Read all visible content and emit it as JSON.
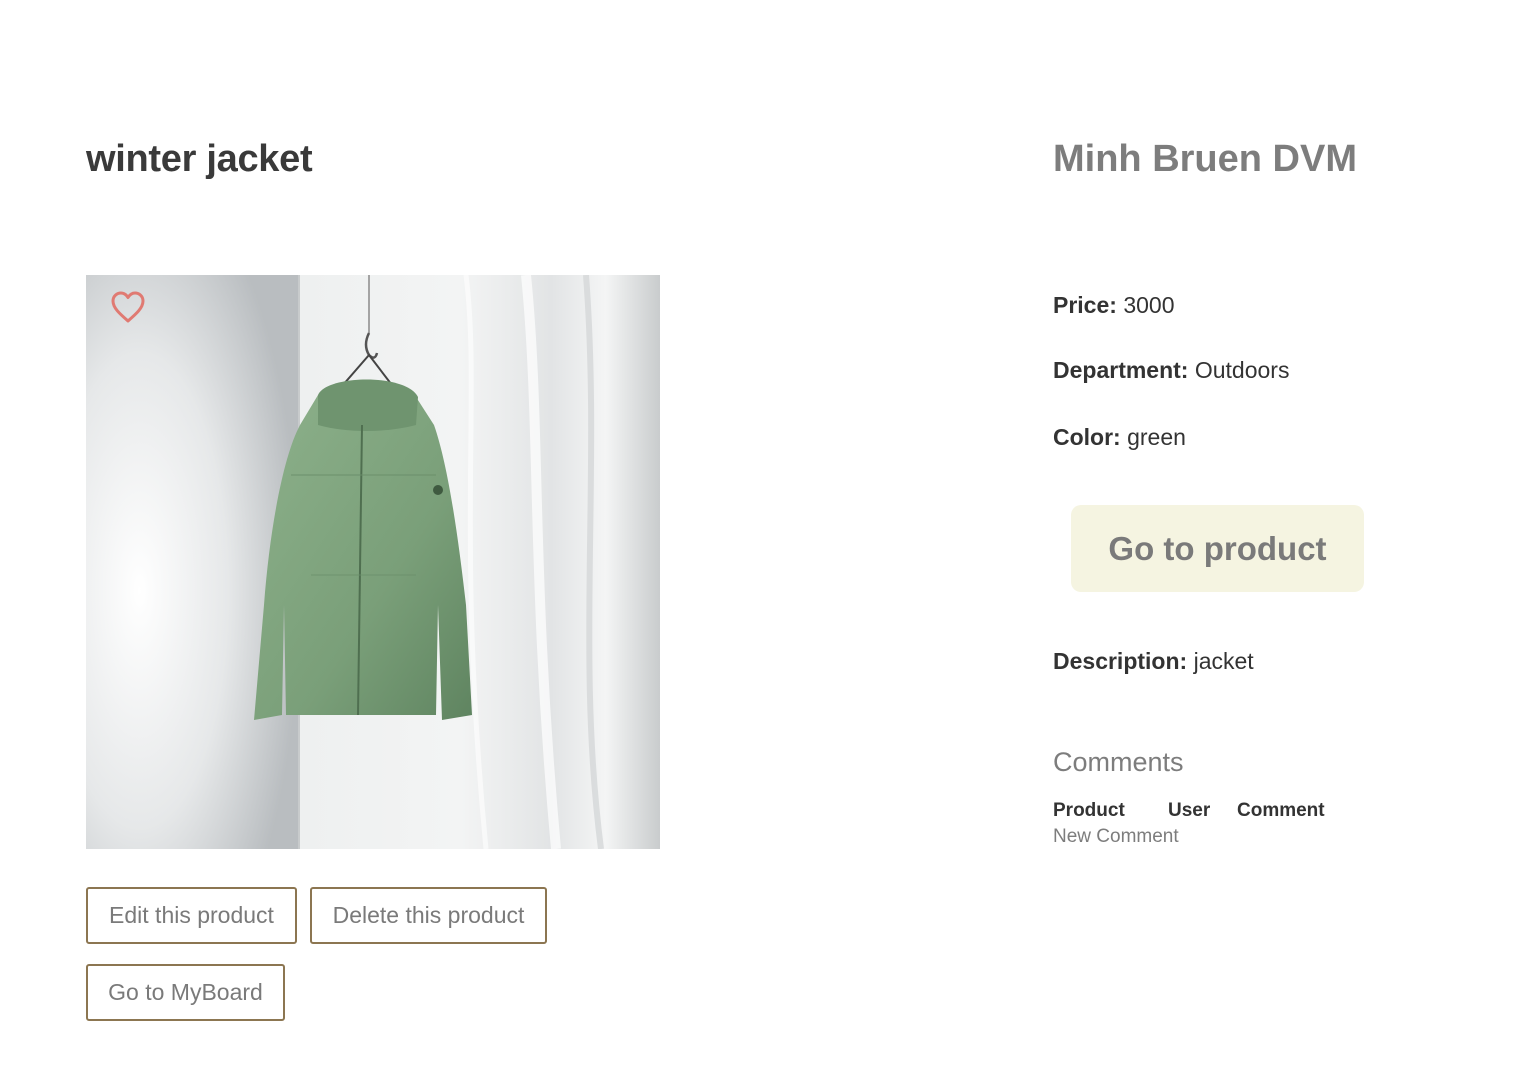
{
  "product": {
    "title": "winter jacket",
    "image_alt": "green hooded jacket hanging on a hook",
    "favorite_icon": "heart-outline-icon",
    "favorite_color": "#e07a72"
  },
  "actions": {
    "edit_label": "Edit this product",
    "delete_label": "Delete this product",
    "myboard_label": "Go to MyBoard"
  },
  "seller": {
    "name": "Minh Bruen DVM"
  },
  "details": {
    "price_label": "Price:",
    "price_value": "3000",
    "department_label": "Department:",
    "department_value": "Outdoors",
    "color_label": "Color:",
    "color_value": "green",
    "description_label": "Description:",
    "description_value": "jacket"
  },
  "go_to_product_label": "Go to product",
  "comments": {
    "title": "Comments",
    "columns": [
      "Product",
      "User",
      "Comment"
    ],
    "new_comment_label": "New Comment"
  },
  "colors": {
    "button_border": "#8c7651",
    "go_button_bg": "#f5f4e1",
    "jacket_green": "#7fa37e"
  }
}
